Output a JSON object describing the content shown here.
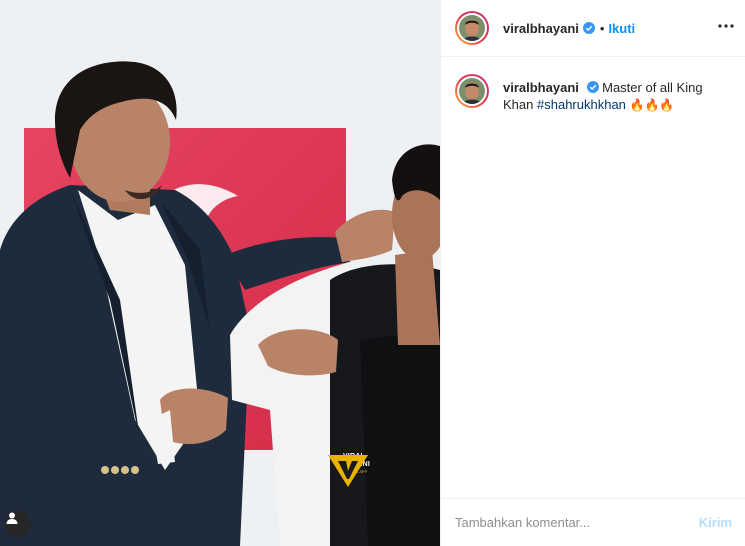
{
  "post": {
    "author": "viralbhayani",
    "verified": true,
    "separator": "•",
    "follow_label": "Ikuti",
    "more_icon": "more-horizontal-icon",
    "caption": {
      "username": "viralbhayani",
      "text_before": "Master of all King Khan",
      "hashtag": "#shahrukhkhan",
      "emoji": "🔥🔥🔥"
    }
  },
  "media": {
    "type": "video-still",
    "watermark_text": "VIRAL BHAYANI",
    "watermark_sub": "OFFICIAL APP",
    "tag_icon": "user-tag-icon"
  },
  "comment": {
    "placeholder": "Tambahkan komentar...",
    "post_label": "Kirim"
  },
  "colors": {
    "accent": "#0095f6",
    "post_disabled": "#b2dffc",
    "verified": "#3897f0",
    "backdrop_red": "#e23a57"
  }
}
